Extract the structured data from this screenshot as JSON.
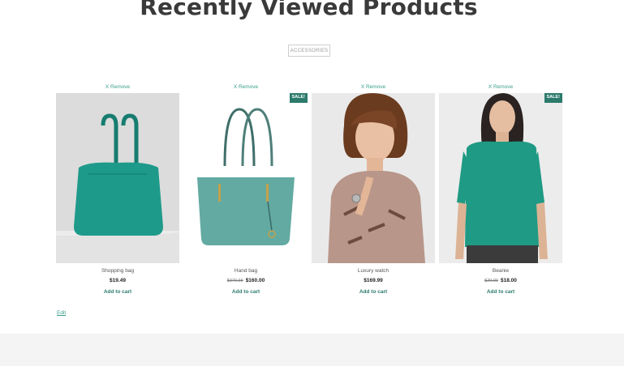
{
  "page": {
    "title": "Recently Viewed Products",
    "filter_tag": "ACCESSORIES",
    "edit_label": "Edit"
  },
  "products": [
    {
      "remove_label": "X Remove",
      "name": "Shopping bag",
      "old_price": "",
      "price": "$19.49",
      "cart_label": "Add to cart",
      "sale_label": "",
      "accent": "#1e9a8a"
    },
    {
      "remove_label": "X Remove",
      "name": "Hand bag",
      "old_price": "$379.99",
      "price": "$160.00",
      "cart_label": "Add to cart",
      "sale_label": "SALE!",
      "accent": "#62aaa2"
    },
    {
      "remove_label": "X Remove",
      "name": "Luxury watch",
      "old_price": "",
      "price": "$169.99",
      "cart_label": "Add to cart",
      "sale_label": "",
      "accent": "#7a4a2a"
    },
    {
      "remove_label": "X Remove",
      "name": "Beanie",
      "old_price": "$20.00",
      "price": "$18.00",
      "cart_label": "Add to cart",
      "sale_label": "SALE!",
      "accent": "#1f9a84"
    }
  ]
}
